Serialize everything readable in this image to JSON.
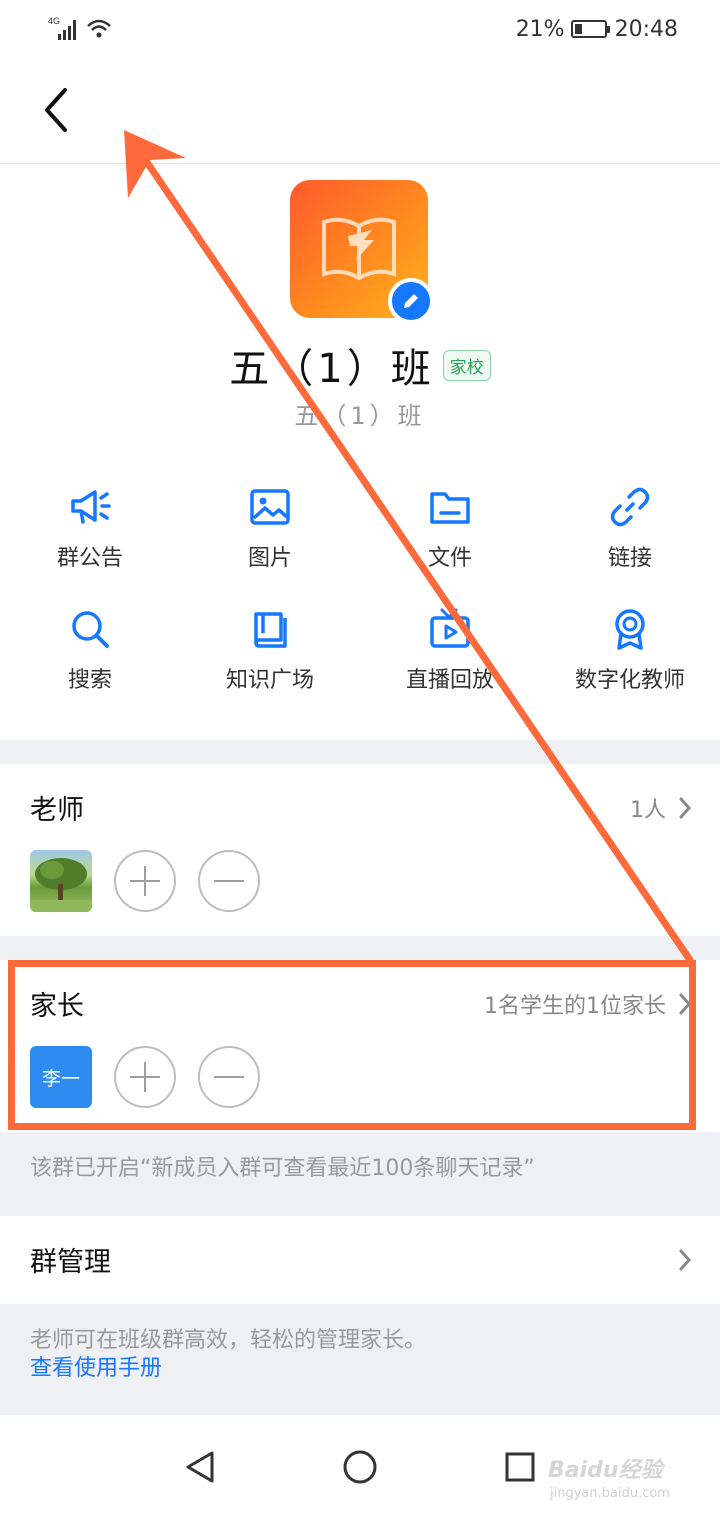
{
  "status_bar": {
    "network": "4G",
    "battery": "21%",
    "time": "20:48"
  },
  "nav": {
    "back_icon": "chevron-left-icon"
  },
  "group": {
    "name": "五（1）班",
    "tag": "家校",
    "subname": "五（1）班",
    "avatar_icon": "book-icon",
    "edit_icon": "pencil-icon"
  },
  "tools": [
    {
      "label": "群公告",
      "icon": "megaphone-icon"
    },
    {
      "label": "图片",
      "icon": "image-icon"
    },
    {
      "label": "文件",
      "icon": "folder-icon"
    },
    {
      "label": "链接",
      "icon": "link-icon"
    },
    {
      "label": "搜索",
      "icon": "search-icon"
    },
    {
      "label": "知识广场",
      "icon": "book-stack-icon"
    },
    {
      "label": "直播回放",
      "icon": "tv-play-icon"
    },
    {
      "label": "数字化教师",
      "icon": "badge-icon"
    }
  ],
  "teachers": {
    "title": "老师",
    "count": "1人"
  },
  "parents": {
    "title": "家长",
    "summary": "1名学生的1位家长",
    "member_name": "李一"
  },
  "history_notice": "该群已开启“新成员入群可查看最近100条聊天记录”",
  "group_manage": {
    "title": "群管理",
    "desc": "老师可在班级群高效，轻松的管理家长。",
    "link": "查看使用手册"
  },
  "watermark": {
    "brand": "Baidu经验",
    "url": "jingyan.baidu.com"
  },
  "colors": {
    "accent": "#1677ff",
    "annotation": "#ff6a3d",
    "tag_green": "#22a35a"
  }
}
